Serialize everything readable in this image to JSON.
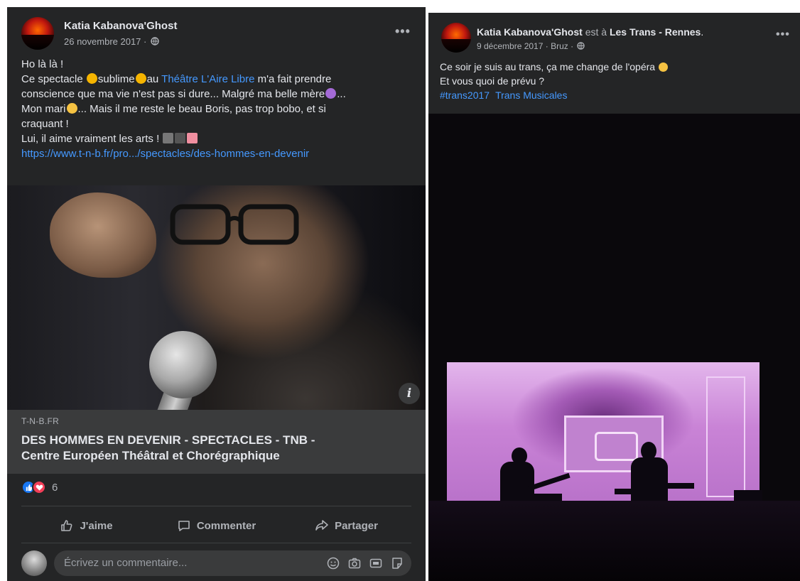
{
  "left_post": {
    "author": "Katia Kabanova'Ghost",
    "date": "26 novembre 2017 ·",
    "privacy_icon": "globe-icon",
    "more_label": "•••",
    "text": {
      "l1": "Ho là là !",
      "l2a": "Ce spectacle ",
      "l2b": "sublime",
      "l2c": "au ",
      "l2_link": "Théâtre L'Aire Libre",
      "l2d": " m'a fait prendre",
      "l3": "conscience que ma vie n'est pas si dure... Malgré ma belle mère",
      "l3b": "...",
      "l4a": "Mon mari",
      "l4b": "... Mais il me reste  le beau Boris, pas trop bobo, et si",
      "l5": "craquant !",
      "l6": "Lui, il aime vraiment les arts ! ",
      "url": "https://www.t-n-b.fr/pro.../spectacles/des-hommes-en-devenir"
    },
    "link_preview": {
      "domain": "T-N-B.FR",
      "title_l1": "DES HOMMES EN DEVENIR - SPECTACLES - TNB -",
      "title_l2": "Centre Européen Théâtral et Chorégraphique",
      "info_label": "i"
    },
    "reactions": {
      "count": "6"
    },
    "actions": {
      "like": "J'aime",
      "comment": "Commenter",
      "share": "Partager"
    },
    "comment_placeholder": "Écrivez un commentaire..."
  },
  "right_post": {
    "author": "Katia Kabanova'Ghost",
    "location_prefix": " est à ",
    "location": "Les Trans - Rennes",
    "location_suffix": ".",
    "date": "9 décembre 2017 · Bruz ·",
    "more_label": "•••",
    "text": {
      "l1": "Ce soir je suis au trans, ça me change de l'opéra ",
      "l2": "Et vous quoi de prévu ?",
      "tag1": "#trans2017",
      "tag2": "Trans Musicales"
    }
  },
  "colors": {
    "card_bg": "#242526",
    "text": "#e4e6eb",
    "muted": "#b0b3b8",
    "link": "#4599ff",
    "like_blue": "#1877f2",
    "love_red": "#f33e58"
  }
}
